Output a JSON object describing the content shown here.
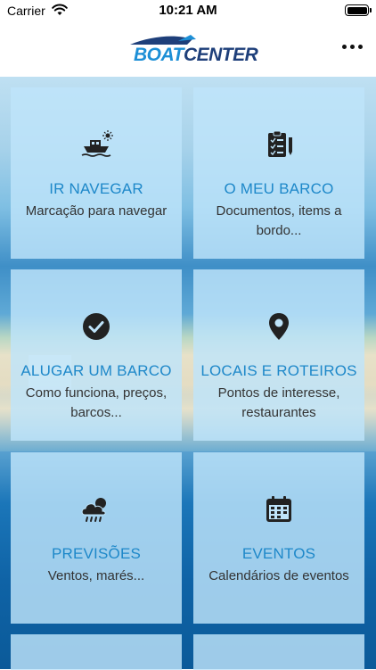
{
  "status_bar": {
    "carrier": "Carrier",
    "time": "10:21 AM"
  },
  "nav": {
    "logo_boat": "BOAT",
    "logo_center": "CENTER"
  },
  "tiles": [
    {
      "title": "IR NAVEGAR",
      "subtitle": "Marcação para navegar",
      "icon": "boat-icon"
    },
    {
      "title": "O MEU BARCO",
      "subtitle": "Documentos, items a bordo...",
      "icon": "clipboard-checklist-icon"
    },
    {
      "title": "ALUGAR UM BARCO",
      "subtitle": "Como funciona, preços, barcos...",
      "icon": "check-circle-icon"
    },
    {
      "title": "LOCAIS E ROTEIROS",
      "subtitle": "Pontos de interesse, restaurantes",
      "icon": "map-pin-icon"
    },
    {
      "title": "PREVISÕES",
      "subtitle": "Ventos, marés...",
      "icon": "weather-cloud-icon"
    },
    {
      "title": "EVENTOS",
      "subtitle": "Calendários de eventos",
      "icon": "calendar-icon"
    }
  ]
}
